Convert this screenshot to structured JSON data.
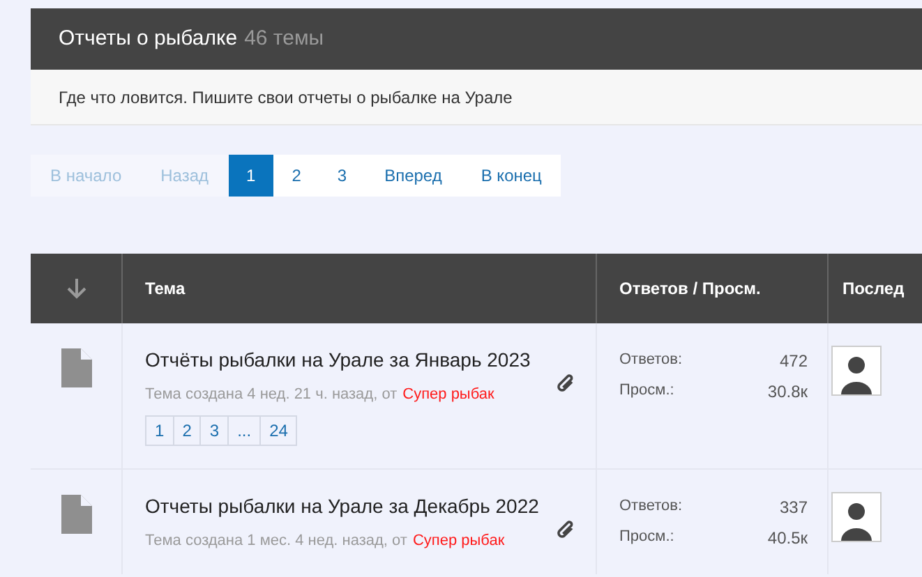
{
  "forum": {
    "title": "Отчеты о рыбалке",
    "count": "46 темы",
    "description": "Где что ловится. Пишите свои отчеты о рыбалке на Урале"
  },
  "pagination": [
    {
      "label": "В начало",
      "disabled": true,
      "selected": false
    },
    {
      "label": "Назад",
      "disabled": true,
      "selected": false
    },
    {
      "label": "1",
      "disabled": false,
      "selected": true
    },
    {
      "label": "2",
      "disabled": false,
      "selected": false
    },
    {
      "label": "3",
      "disabled": false,
      "selected": false
    },
    {
      "label": "Вперед",
      "disabled": false,
      "selected": false
    },
    {
      "label": "В конец",
      "disabled": false,
      "selected": false
    }
  ],
  "table": {
    "columns": [
      "Тема",
      "Ответов / Просм.",
      "Послед"
    ],
    "rows": [
      {
        "title": "Отчёты рыбалки на Урале за Январь 2023",
        "meta": "Тема создана 4 нед. 21 ч. назад, от",
        "author": "Супер рыбак",
        "pages": [
          "1",
          "2",
          "3",
          "...",
          "24"
        ],
        "replies_label": "Ответов:",
        "replies": "472",
        "views_label": "Просм.:",
        "views": "30.8к"
      },
      {
        "title": "Отчеты рыбалки на Урале за Декабрь 2022",
        "meta": "Тема создана 1 мес. 4 нед. назад, от",
        "author": "Супер рыбак",
        "replies_label": "Ответов:",
        "replies": "337",
        "views_label": "Просм.:",
        "views": "40.5к"
      }
    ]
  }
}
